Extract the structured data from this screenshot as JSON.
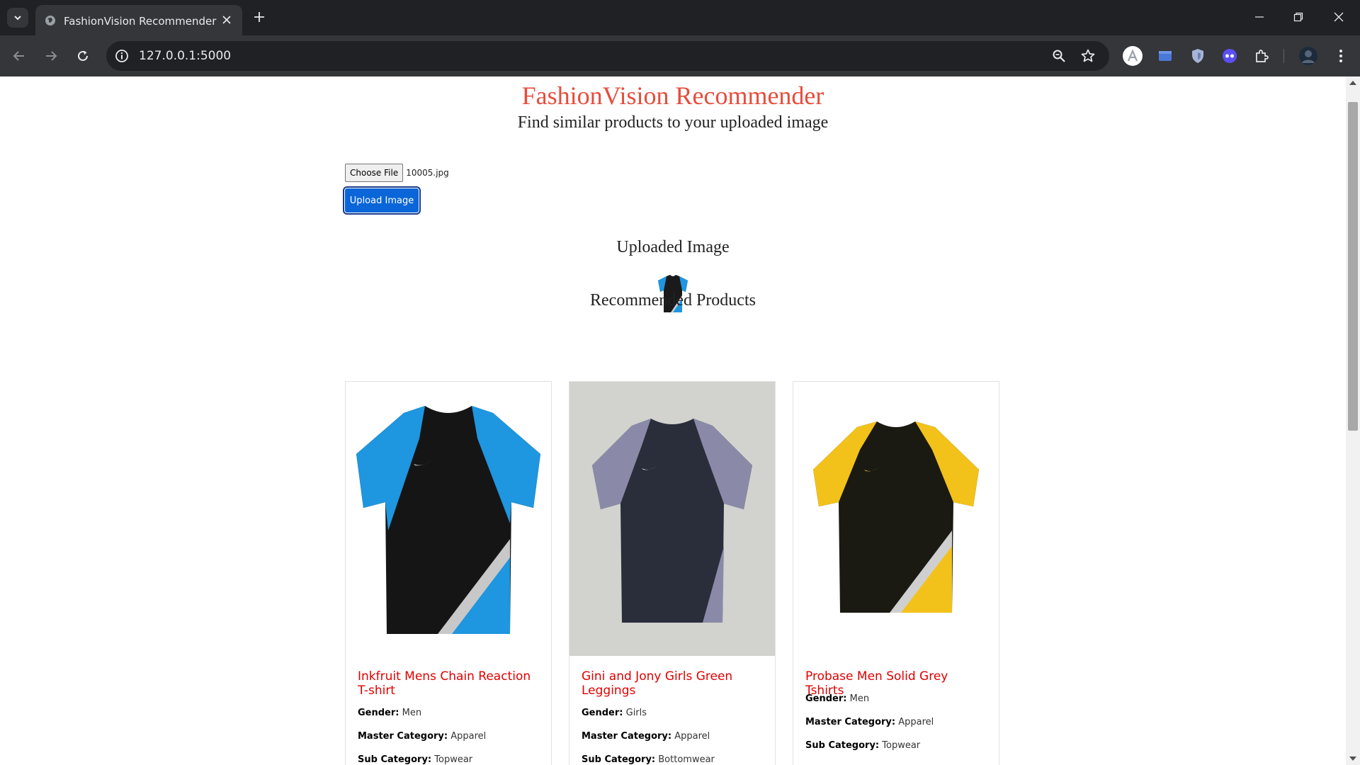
{
  "browser": {
    "tab_title": "FashionVision Recommender",
    "url": "127.0.0.1:5000"
  },
  "page": {
    "title": "FashionVision Recommender",
    "subtitle": "Find similar products to your uploaded image",
    "file_input": {
      "button_label": "Choose File",
      "file_name": "10005.jpg"
    },
    "upload_button": "Upload Image",
    "uploaded_heading": "Uploaded Image",
    "recommended_heading": "Recommended Products",
    "attr_labels": {
      "gender": "Gender:",
      "master_category": "Master Category:",
      "sub_category": "Sub Category:"
    },
    "products": [
      {
        "name": "Inkfruit Mens Chain Reaction T-shirt",
        "gender": "Men",
        "master_category": "Apparel",
        "sub_category": "Topwear",
        "sleeve_color": "#1e96e0",
        "accent_color": "#1e96e0",
        "bg_color": "#ffffff"
      },
      {
        "name": "Gini and Jony Girls Green Leggings",
        "gender": "Girls",
        "master_category": "Apparel",
        "sub_category": "Bottomwear",
        "sleeve_color": "#8a8aa8",
        "accent_color": "#2a2d3a",
        "bg_color": "#d2d2ce"
      },
      {
        "name": "Probase Men Solid Grey Tshirts",
        "gender": "Men",
        "master_category": "Apparel",
        "sub_category": "Topwear",
        "sleeve_color": "#f2c21a",
        "accent_color": "#f2c21a",
        "bg_color": "#ffffff"
      }
    ]
  },
  "colors": {
    "title": "#e74c3c",
    "product_name": "#e00000",
    "upload_button": "#0a66d8"
  }
}
